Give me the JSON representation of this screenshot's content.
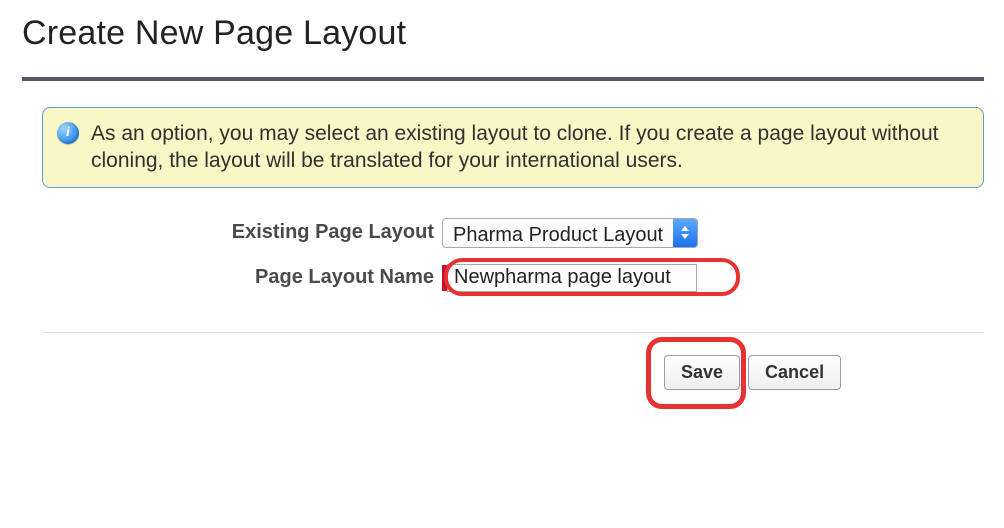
{
  "page": {
    "title": "Create New Page Layout"
  },
  "info": {
    "text": "As an option, you may select an existing layout to clone. If you create a page layout without cloning, the layout will be translated for your international users."
  },
  "form": {
    "existing_layout_label": "Existing Page Layout",
    "existing_layout_value": "Pharma Product Layout",
    "name_label": "Page Layout Name",
    "name_value": "Newpharma page layout"
  },
  "buttons": {
    "save": "Save",
    "cancel": "Cancel"
  }
}
